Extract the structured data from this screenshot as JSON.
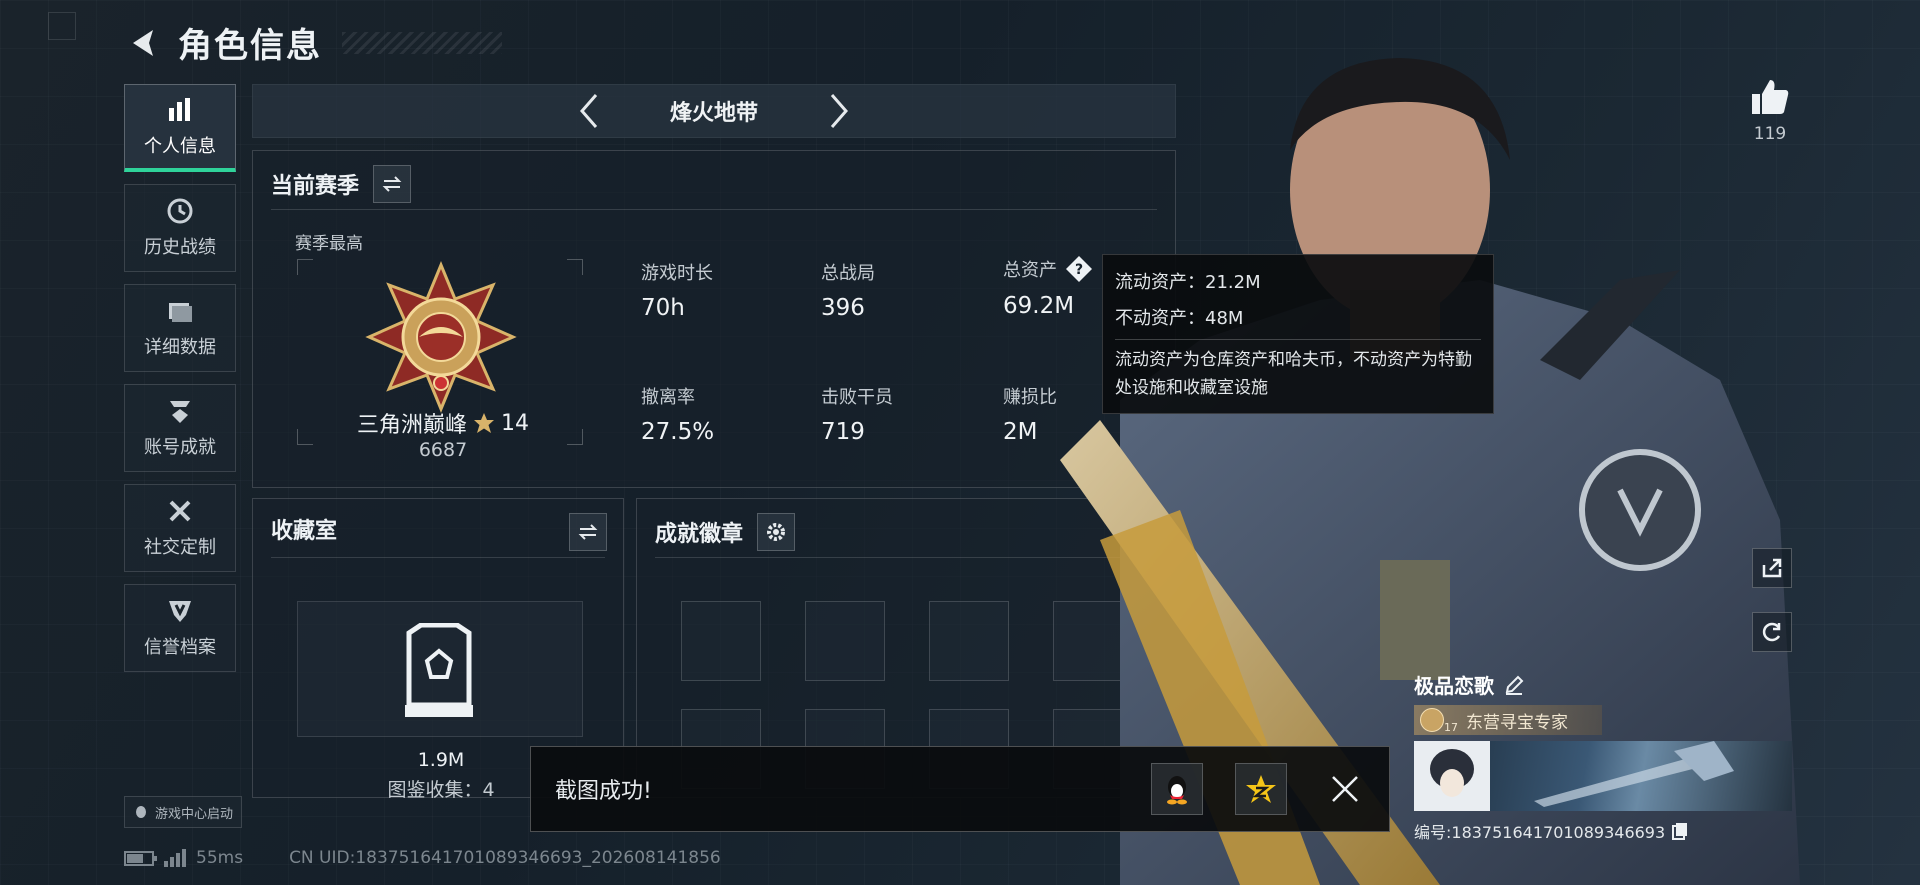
{
  "header": {
    "title": "角色信息"
  },
  "nav": {
    "items": [
      {
        "label": "个人信息",
        "icon": "bar-chart-icon",
        "active": true
      },
      {
        "label": "历史战绩",
        "icon": "clock-icon"
      },
      {
        "label": "详细数据",
        "icon": "folder-icon"
      },
      {
        "label": "账号成就",
        "icon": "achievement-icon"
      },
      {
        "label": "社交定制",
        "icon": "tools-icon"
      },
      {
        "label": "信誉档案",
        "icon": "shield-icon"
      }
    ],
    "launch_label": "游戏中心启动"
  },
  "mode": {
    "title": "烽火地带"
  },
  "season": {
    "title": "当前赛季",
    "subtitle": "赛季最高",
    "rank_name": "三角洲巅峰",
    "rank_stars": "14",
    "rank_score": "6687",
    "stats": [
      {
        "label": "游戏时长",
        "value": "70h"
      },
      {
        "label": "总战局",
        "value": "396"
      },
      {
        "label": "总资产",
        "value": "69.2M"
      },
      {
        "label": "撤离率",
        "value": "27.5%"
      },
      {
        "label": "击败干员",
        "value": "719"
      },
      {
        "label": "赚损比",
        "value": "2M"
      }
    ]
  },
  "tooltip": {
    "line1": "流动资产：21.2M",
    "line2": "不动资产：48M",
    "desc": "流动资产为仓库资产和哈夫币，不动资产为特勤处设施和收藏室设施"
  },
  "collection": {
    "title": "收藏室",
    "value": "1.9M",
    "count_text": "图鉴收集：4"
  },
  "achievements": {
    "title": "成就徽章"
  },
  "toast": {
    "text": "截图成功!"
  },
  "like": {
    "count": "119"
  },
  "profile": {
    "name": "极品恋歌",
    "title_badge": "东营寻宝专家",
    "badge_level": "17",
    "player_id": "编号:1837516417010893466​93"
  },
  "status": {
    "latency": "55ms",
    "uid": "CN UID:183751641701089346693_202608141856",
    "battery_level": 0.6
  },
  "colors": {
    "accent": "#2fd39a",
    "gold": "#c9a464"
  }
}
